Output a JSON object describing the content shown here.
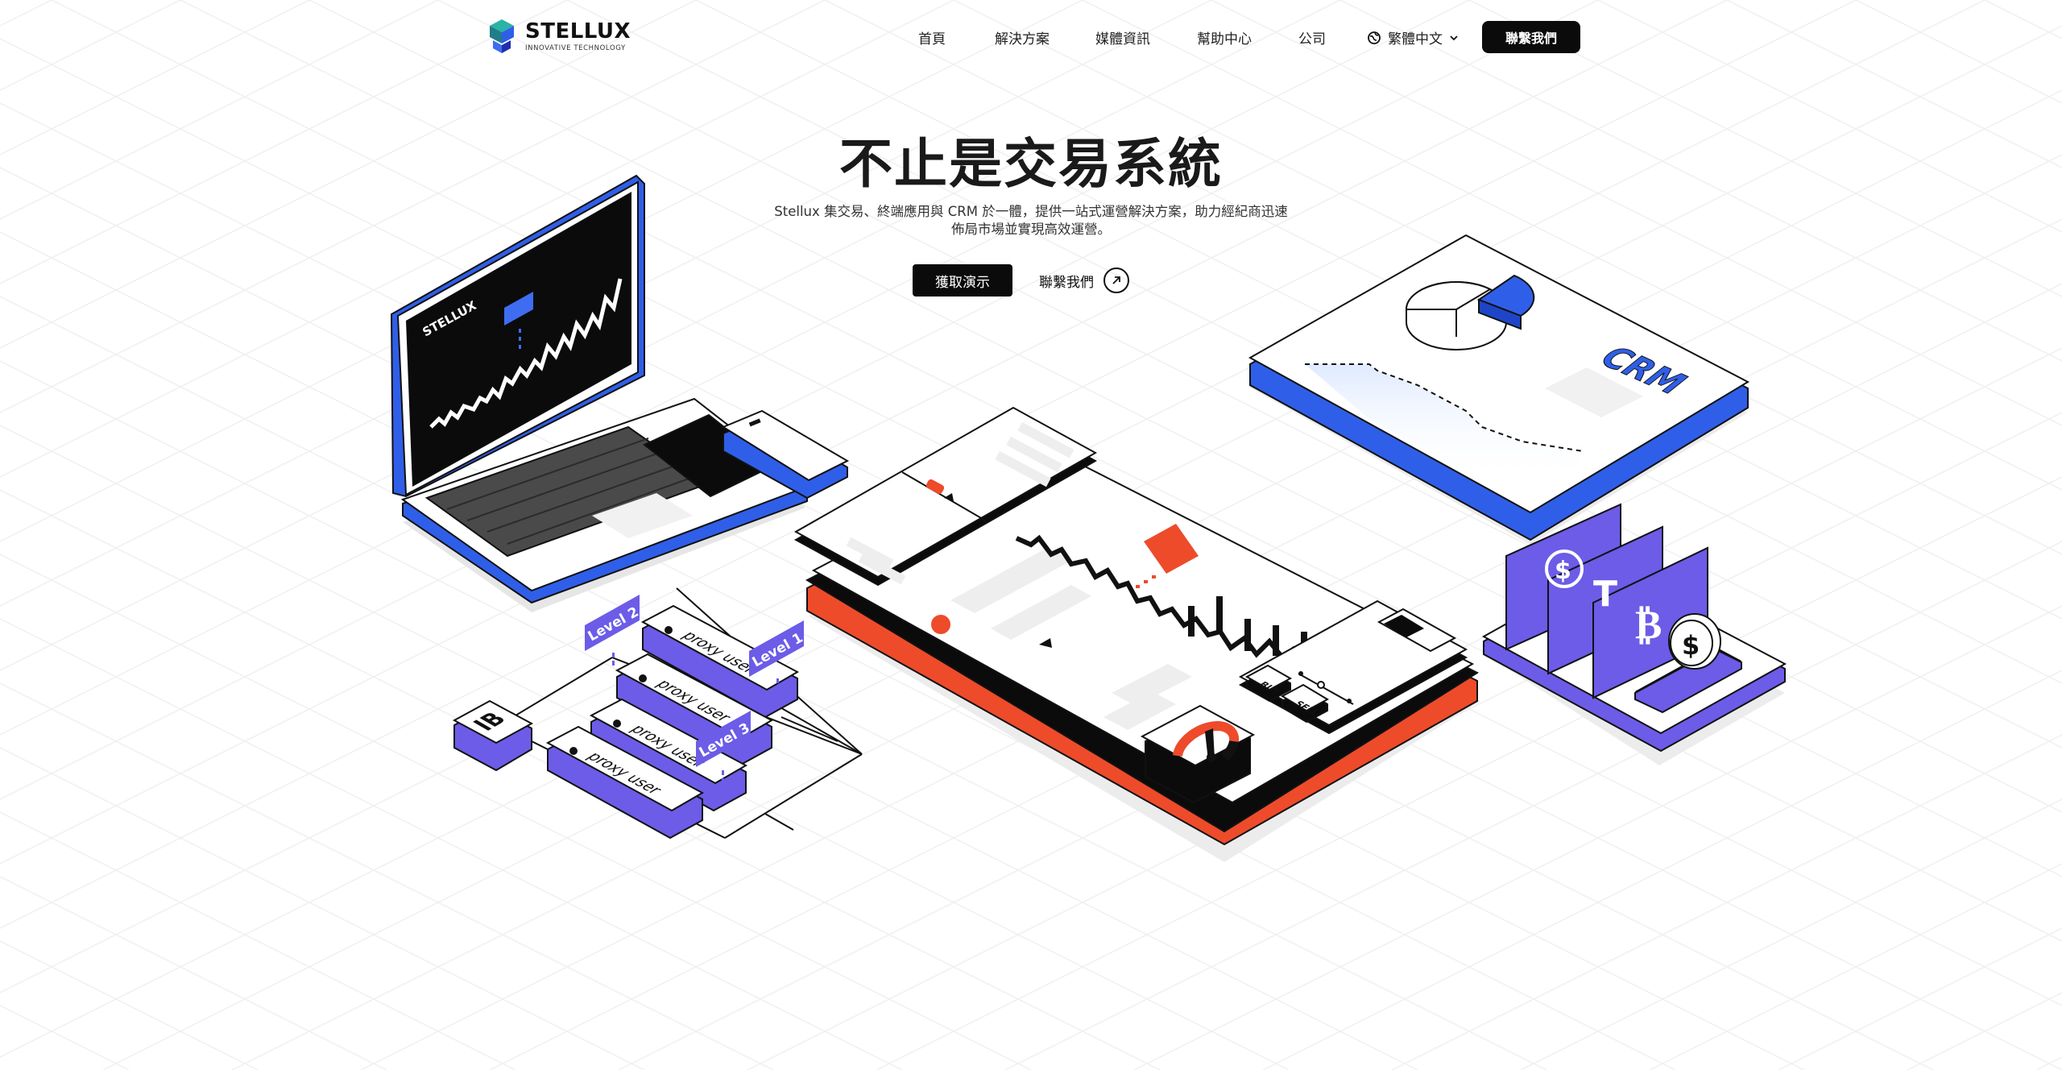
{
  "brand": {
    "name": "STELLUX",
    "tagline": "INNOVATIVE TECHNOLOGY"
  },
  "nav": {
    "items": [
      {
        "label": "首頁"
      },
      {
        "label": "解決方案"
      },
      {
        "label": "媒體資訊"
      },
      {
        "label": "幫助中心"
      },
      {
        "label": "公司"
      }
    ],
    "language": "繁體中文",
    "contact_button": "聯繫我們"
  },
  "hero": {
    "title": "不止是交易系統",
    "description_line1": "Stellux 集交易、終端應用與 CRM 於一體，提供一站式運營解決方案，助力經紀商迅速",
    "description_line2": "佈局市場並實現高效運營。",
    "demo_button": "獲取演示",
    "contact_link": "聯繫我們"
  },
  "illustration": {
    "laptop_brand": "STELLUX",
    "crm_label": "CRM",
    "ib_label": "IB",
    "levels": [
      "Level 1",
      "Level 2",
      "Level 3"
    ],
    "proxy_label": "proxy user",
    "trade_buttons": [
      "BUY",
      "SELL"
    ]
  },
  "colors": {
    "primary_blue": "#2f5fe8",
    "violet": "#6c5ce7",
    "orange": "#ee4b2b",
    "black": "#0b0b0b"
  }
}
